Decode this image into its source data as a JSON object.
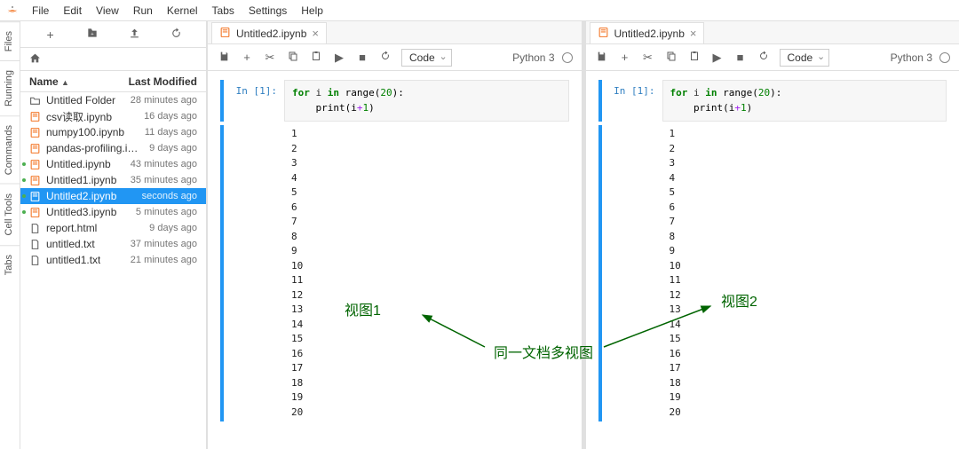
{
  "menu": [
    "File",
    "Edit",
    "View",
    "Run",
    "Kernel",
    "Tabs",
    "Settings",
    "Help"
  ],
  "side_tabs": [
    "Files",
    "Running",
    "Commands",
    "Cell Tools",
    "Tabs"
  ],
  "filebrowser": {
    "header_name": "Name",
    "header_modified": "Last Modified",
    "items": [
      {
        "type": "folder",
        "name": "Untitled Folder",
        "time": "28 minutes ago",
        "running": false
      },
      {
        "type": "notebook",
        "name": "csv读取.ipynb",
        "time": "16 days ago",
        "running": false
      },
      {
        "type": "notebook",
        "name": "numpy100.ipynb",
        "time": "11 days ago",
        "running": false
      },
      {
        "type": "notebook",
        "name": "pandas-profiling.ipynb",
        "time": "9 days ago",
        "running": false
      },
      {
        "type": "notebook",
        "name": "Untitled.ipynb",
        "time": "43 minutes ago",
        "running": true
      },
      {
        "type": "notebook",
        "name": "Untitled1.ipynb",
        "time": "35 minutes ago",
        "running": true
      },
      {
        "type": "notebook",
        "name": "Untitled2.ipynb",
        "time": "seconds ago",
        "running": true,
        "selected": true
      },
      {
        "type": "notebook",
        "name": "Untitled3.ipynb",
        "time": "5 minutes ago",
        "running": true
      },
      {
        "type": "file",
        "name": "report.html",
        "time": "9 days ago",
        "running": false
      },
      {
        "type": "file",
        "name": "untitled.txt",
        "time": "37 minutes ago",
        "running": false
      },
      {
        "type": "file",
        "name": "untitled1.txt",
        "time": "21 minutes ago",
        "running": false
      }
    ]
  },
  "notebook": {
    "tab_title": "Untitled2.ipynb",
    "kernel": "Python 3",
    "cell_type": "Code",
    "prompt": "In [1]:",
    "code_tokens": [
      {
        "t": "for ",
        "c": "kw"
      },
      {
        "t": "i ",
        "c": ""
      },
      {
        "t": "in ",
        "c": "kw"
      },
      {
        "t": "range",
        "c": "fn"
      },
      {
        "t": "(",
        "c": "paren"
      },
      {
        "t": "20",
        "c": "num"
      },
      {
        "t": "):",
        "c": "paren"
      },
      {
        "t": "\n    ",
        "c": ""
      },
      {
        "t": "print",
        "c": "fn"
      },
      {
        "t": "(i",
        "c": "paren"
      },
      {
        "t": "+",
        "c": "op"
      },
      {
        "t": "1",
        "c": "num"
      },
      {
        "t": ")",
        "c": "paren"
      }
    ],
    "output_lines": [
      "1",
      "2",
      "3",
      "4",
      "5",
      "6",
      "7",
      "8",
      "9",
      "10",
      "11",
      "12",
      "13",
      "14",
      "15",
      "16",
      "17",
      "18",
      "19",
      "20"
    ]
  },
  "annotations": {
    "view1": "视图1",
    "view2": "视图2",
    "caption": "同一文档多视图"
  }
}
